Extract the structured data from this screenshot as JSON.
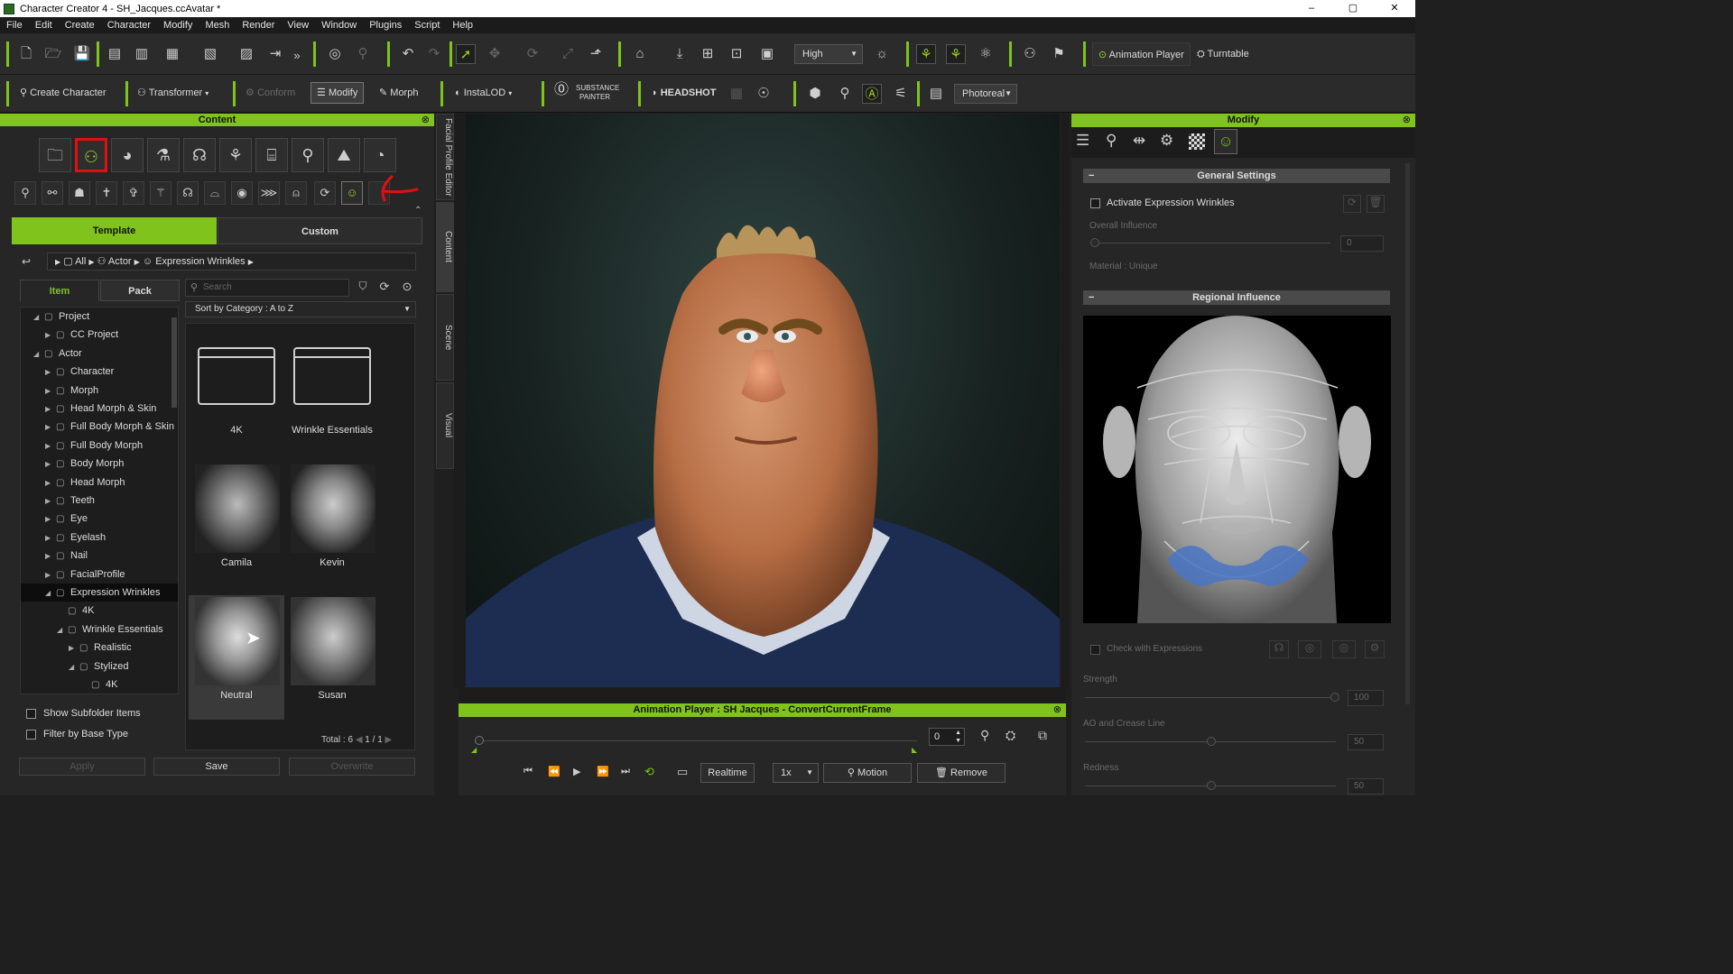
{
  "window": {
    "title": "Character Creator 4 - SH_Jacques.ccAvatar *",
    "min": "–",
    "max": "▢",
    "close": "✕"
  },
  "menu": [
    "File",
    "Edit",
    "Create",
    "Character",
    "Modify",
    "Mesh",
    "Render",
    "View",
    "Window",
    "Plugins",
    "Script",
    "Help"
  ],
  "toolbar1": {
    "quality": "High",
    "animation_player": "Animation Player",
    "turntable": "Turntable"
  },
  "toolbar2": {
    "create_character": "Create Character",
    "transformer": "Transformer",
    "conform": "Conform",
    "modify": "Modify",
    "morph": "Morph",
    "instalod": "InstaLOD",
    "substance_1": "SUBSTANCE",
    "substance_2": "PAINTER",
    "headshot": "HEADSHOT",
    "render_mode": "Photoreal"
  },
  "content": {
    "title": "Content",
    "tabs": [
      "Template",
      "Custom"
    ],
    "breadcrumb": [
      "All",
      "Actor",
      "Expression Wrinkles"
    ],
    "subtabs": [
      "Item",
      "Pack"
    ],
    "search_placeholder": "Search",
    "sort": "Sort by Category : A to Z",
    "tree": [
      {
        "label": "Project",
        "depth": 0,
        "open": true
      },
      {
        "label": "CC Project",
        "depth": 1,
        "open": false
      },
      {
        "label": "Actor",
        "depth": 0,
        "open": true
      },
      {
        "label": "Character",
        "depth": 1,
        "open": false
      },
      {
        "label": "Morph",
        "depth": 1,
        "open": false
      },
      {
        "label": "Head Morph & Skin",
        "depth": 1,
        "open": false
      },
      {
        "label": "Full Body Morph & Skin",
        "depth": 1,
        "open": false
      },
      {
        "label": "Full Body Morph",
        "depth": 1,
        "open": false
      },
      {
        "label": "Body Morph",
        "depth": 1,
        "open": false
      },
      {
        "label": "Head Morph",
        "depth": 1,
        "open": false
      },
      {
        "label": "Teeth",
        "depth": 1,
        "open": false
      },
      {
        "label": "Eye",
        "depth": 1,
        "open": false
      },
      {
        "label": "Eyelash",
        "depth": 1,
        "open": false
      },
      {
        "label": "Nail",
        "depth": 1,
        "open": false
      },
      {
        "label": "FacialProfile",
        "depth": 1,
        "open": false
      },
      {
        "label": "Expression Wrinkles",
        "depth": 1,
        "open": true,
        "selected": true
      },
      {
        "label": "4K",
        "depth": 2,
        "leaf": true
      },
      {
        "label": "Wrinkle Essentials",
        "depth": 2,
        "open": true
      },
      {
        "label": "Realistic",
        "depth": 3,
        "open": false
      },
      {
        "label": "Stylized",
        "depth": 3,
        "open": true
      },
      {
        "label": "4K",
        "depth": 4,
        "leaf": true
      }
    ],
    "items": [
      "4K",
      "Wrinkle Essentials",
      "Camila",
      "Kevin",
      "Neutral",
      "Susan"
    ],
    "show_subfolder": "Show Subfolder Items",
    "filter_base": "Filter by Base Type",
    "total": "Total : 6",
    "page": "1  /  1",
    "apply": "Apply",
    "save": "Save",
    "overwrite": "Overwrite"
  },
  "side_tabs": [
    "Facial Profile Editor",
    "Content",
    "Scene",
    "Visual"
  ],
  "animation_player": {
    "title": "Animation Player : SH Jacques - ConvertCurrentFrame",
    "frame": "0",
    "realtime": "Realtime",
    "speed": "1x",
    "motion": "Motion",
    "remove": "Remove"
  },
  "modify": {
    "title": "Modify",
    "general_settings": "General Settings",
    "activate": "Activate Expression Wrinkles",
    "overall_influence": "Overall Influence",
    "overall_value": "0",
    "material": "Material : Unique",
    "regional_influence": "Regional Influence",
    "check_expr": "Check with Expressions",
    "strength": "Strength",
    "strength_value": "100",
    "ao": "AO and Crease Line",
    "ao_value": "50",
    "redness": "Redness",
    "redness_value": "50"
  }
}
